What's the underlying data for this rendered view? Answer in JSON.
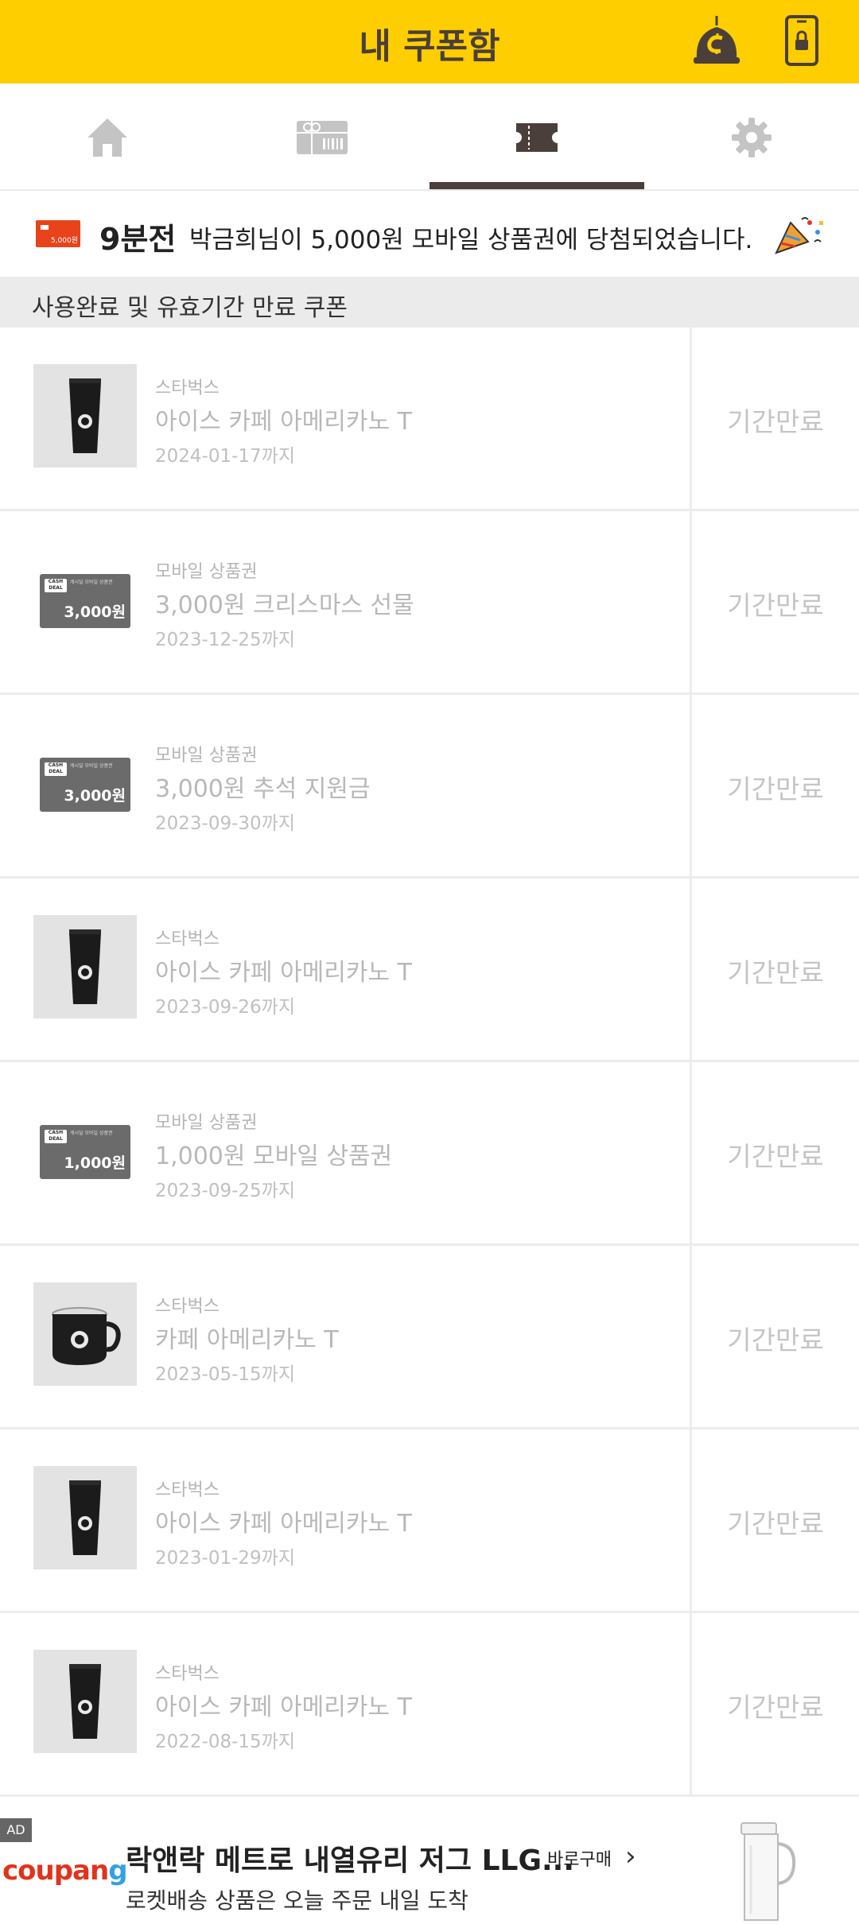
{
  "header": {
    "title": "내 쿠폰함"
  },
  "tabs": [
    {
      "name": "home",
      "icon": "home-icon",
      "active": false
    },
    {
      "name": "gift",
      "icon": "gift-card-icon",
      "active": false
    },
    {
      "name": "coupons",
      "icon": "ticket-icon",
      "active": true
    },
    {
      "name": "settings",
      "icon": "gear-icon",
      "active": false
    }
  ],
  "notice": {
    "thumb_amount": "5,000원",
    "time": "9분전",
    "text": "박금희님이 5,000원 모바일 상품권에 당첨되었습니다."
  },
  "section": {
    "title": "사용완료 및 유효기간 만료 쿠폰"
  },
  "coupons": [
    {
      "type": "coffee",
      "brand": "스타벅스",
      "name": "아이스 카페 아메리카노 T",
      "date": "2024-01-17까지",
      "status": "기간만료"
    },
    {
      "type": "card",
      "card_amount": "3,000원",
      "brand": "모바일 상품권",
      "name": "3,000원 크리스마스 선물",
      "date": "2023-12-25까지",
      "status": "기간만료"
    },
    {
      "type": "card",
      "card_amount": "3,000원",
      "brand": "모바일 상품권",
      "name": "3,000원 추석 지원금",
      "date": "2023-09-30까지",
      "status": "기간만료"
    },
    {
      "type": "coffee",
      "brand": "스타벅스",
      "name": "아이스 카페 아메리카노 T",
      "date": "2023-09-26까지",
      "status": "기간만료"
    },
    {
      "type": "card",
      "card_amount": "1,000원",
      "brand": "모바일 상품권",
      "name": "1,000원 모바일 상품권",
      "date": "2023-09-25까지",
      "status": "기간만료"
    },
    {
      "type": "mug",
      "brand": "스타벅스",
      "name": "카페 아메리카노 T",
      "date": "2023-05-15까지",
      "status": "기간만료"
    },
    {
      "type": "coffee",
      "brand": "스타벅스",
      "name": "아이스 카페 아메리카노 T",
      "date": "2023-01-29까지",
      "status": "기간만료"
    },
    {
      "type": "coffee",
      "brand": "스타벅스",
      "name": "아이스 카페 아메리카노 T",
      "date": "2022-08-15까지",
      "status": "기간만료"
    }
  ],
  "card_label": {
    "tag": "CASH DEAL",
    "small": "캐시딜 모바일 상품권"
  },
  "ad": {
    "tag": "AD",
    "logo_main": "coupan",
    "logo_g": "g",
    "title": "락앤락 메트로 내열유리 저그 LLG...",
    "buy": "바로구매",
    "chevron": "›",
    "sub": "로켓배송 상품은 오늘 주문 내일 도착"
  },
  "colors": {
    "header_bg": "#FFCE00",
    "accent": "#4a3f3a",
    "expired_text": "#c5c5c5"
  }
}
